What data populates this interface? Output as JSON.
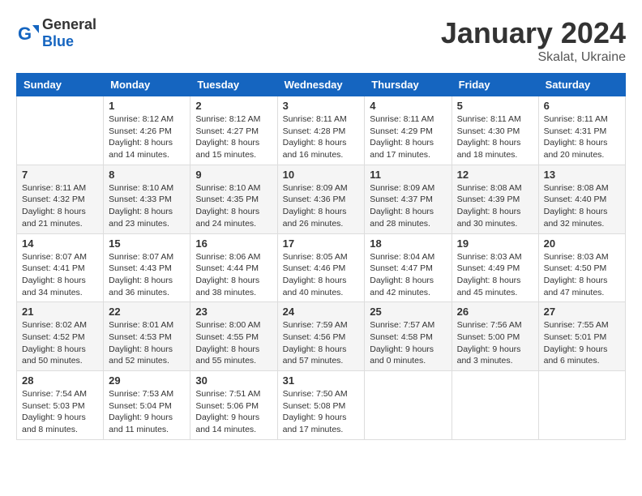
{
  "header": {
    "logo_general": "General",
    "logo_blue": "Blue",
    "month_year": "January 2024",
    "location": "Skalat, Ukraine"
  },
  "days_of_week": [
    "Sunday",
    "Monday",
    "Tuesday",
    "Wednesday",
    "Thursday",
    "Friday",
    "Saturday"
  ],
  "weeks": [
    [
      {
        "day": "",
        "info": ""
      },
      {
        "day": "1",
        "info": "Sunrise: 8:12 AM\nSunset: 4:26 PM\nDaylight: 8 hours\nand 14 minutes."
      },
      {
        "day": "2",
        "info": "Sunrise: 8:12 AM\nSunset: 4:27 PM\nDaylight: 8 hours\nand 15 minutes."
      },
      {
        "day": "3",
        "info": "Sunrise: 8:11 AM\nSunset: 4:28 PM\nDaylight: 8 hours\nand 16 minutes."
      },
      {
        "day": "4",
        "info": "Sunrise: 8:11 AM\nSunset: 4:29 PM\nDaylight: 8 hours\nand 17 minutes."
      },
      {
        "day": "5",
        "info": "Sunrise: 8:11 AM\nSunset: 4:30 PM\nDaylight: 8 hours\nand 18 minutes."
      },
      {
        "day": "6",
        "info": "Sunrise: 8:11 AM\nSunset: 4:31 PM\nDaylight: 8 hours\nand 20 minutes."
      }
    ],
    [
      {
        "day": "7",
        "info": "Sunrise: 8:11 AM\nSunset: 4:32 PM\nDaylight: 8 hours\nand 21 minutes."
      },
      {
        "day": "8",
        "info": "Sunrise: 8:10 AM\nSunset: 4:33 PM\nDaylight: 8 hours\nand 23 minutes."
      },
      {
        "day": "9",
        "info": "Sunrise: 8:10 AM\nSunset: 4:35 PM\nDaylight: 8 hours\nand 24 minutes."
      },
      {
        "day": "10",
        "info": "Sunrise: 8:09 AM\nSunset: 4:36 PM\nDaylight: 8 hours\nand 26 minutes."
      },
      {
        "day": "11",
        "info": "Sunrise: 8:09 AM\nSunset: 4:37 PM\nDaylight: 8 hours\nand 28 minutes."
      },
      {
        "day": "12",
        "info": "Sunrise: 8:08 AM\nSunset: 4:39 PM\nDaylight: 8 hours\nand 30 minutes."
      },
      {
        "day": "13",
        "info": "Sunrise: 8:08 AM\nSunset: 4:40 PM\nDaylight: 8 hours\nand 32 minutes."
      }
    ],
    [
      {
        "day": "14",
        "info": "Sunrise: 8:07 AM\nSunset: 4:41 PM\nDaylight: 8 hours\nand 34 minutes."
      },
      {
        "day": "15",
        "info": "Sunrise: 8:07 AM\nSunset: 4:43 PM\nDaylight: 8 hours\nand 36 minutes."
      },
      {
        "day": "16",
        "info": "Sunrise: 8:06 AM\nSunset: 4:44 PM\nDaylight: 8 hours\nand 38 minutes."
      },
      {
        "day": "17",
        "info": "Sunrise: 8:05 AM\nSunset: 4:46 PM\nDaylight: 8 hours\nand 40 minutes."
      },
      {
        "day": "18",
        "info": "Sunrise: 8:04 AM\nSunset: 4:47 PM\nDaylight: 8 hours\nand 42 minutes."
      },
      {
        "day": "19",
        "info": "Sunrise: 8:03 AM\nSunset: 4:49 PM\nDaylight: 8 hours\nand 45 minutes."
      },
      {
        "day": "20",
        "info": "Sunrise: 8:03 AM\nSunset: 4:50 PM\nDaylight: 8 hours\nand 47 minutes."
      }
    ],
    [
      {
        "day": "21",
        "info": "Sunrise: 8:02 AM\nSunset: 4:52 PM\nDaylight: 8 hours\nand 50 minutes."
      },
      {
        "day": "22",
        "info": "Sunrise: 8:01 AM\nSunset: 4:53 PM\nDaylight: 8 hours\nand 52 minutes."
      },
      {
        "day": "23",
        "info": "Sunrise: 8:00 AM\nSunset: 4:55 PM\nDaylight: 8 hours\nand 55 minutes."
      },
      {
        "day": "24",
        "info": "Sunrise: 7:59 AM\nSunset: 4:56 PM\nDaylight: 8 hours\nand 57 minutes."
      },
      {
        "day": "25",
        "info": "Sunrise: 7:57 AM\nSunset: 4:58 PM\nDaylight: 9 hours\nand 0 minutes."
      },
      {
        "day": "26",
        "info": "Sunrise: 7:56 AM\nSunset: 5:00 PM\nDaylight: 9 hours\nand 3 minutes."
      },
      {
        "day": "27",
        "info": "Sunrise: 7:55 AM\nSunset: 5:01 PM\nDaylight: 9 hours\nand 6 minutes."
      }
    ],
    [
      {
        "day": "28",
        "info": "Sunrise: 7:54 AM\nSunset: 5:03 PM\nDaylight: 9 hours\nand 8 minutes."
      },
      {
        "day": "29",
        "info": "Sunrise: 7:53 AM\nSunset: 5:04 PM\nDaylight: 9 hours\nand 11 minutes."
      },
      {
        "day": "30",
        "info": "Sunrise: 7:51 AM\nSunset: 5:06 PM\nDaylight: 9 hours\nand 14 minutes."
      },
      {
        "day": "31",
        "info": "Sunrise: 7:50 AM\nSunset: 5:08 PM\nDaylight: 9 hours\nand 17 minutes."
      },
      {
        "day": "",
        "info": ""
      },
      {
        "day": "",
        "info": ""
      },
      {
        "day": "",
        "info": ""
      }
    ]
  ]
}
